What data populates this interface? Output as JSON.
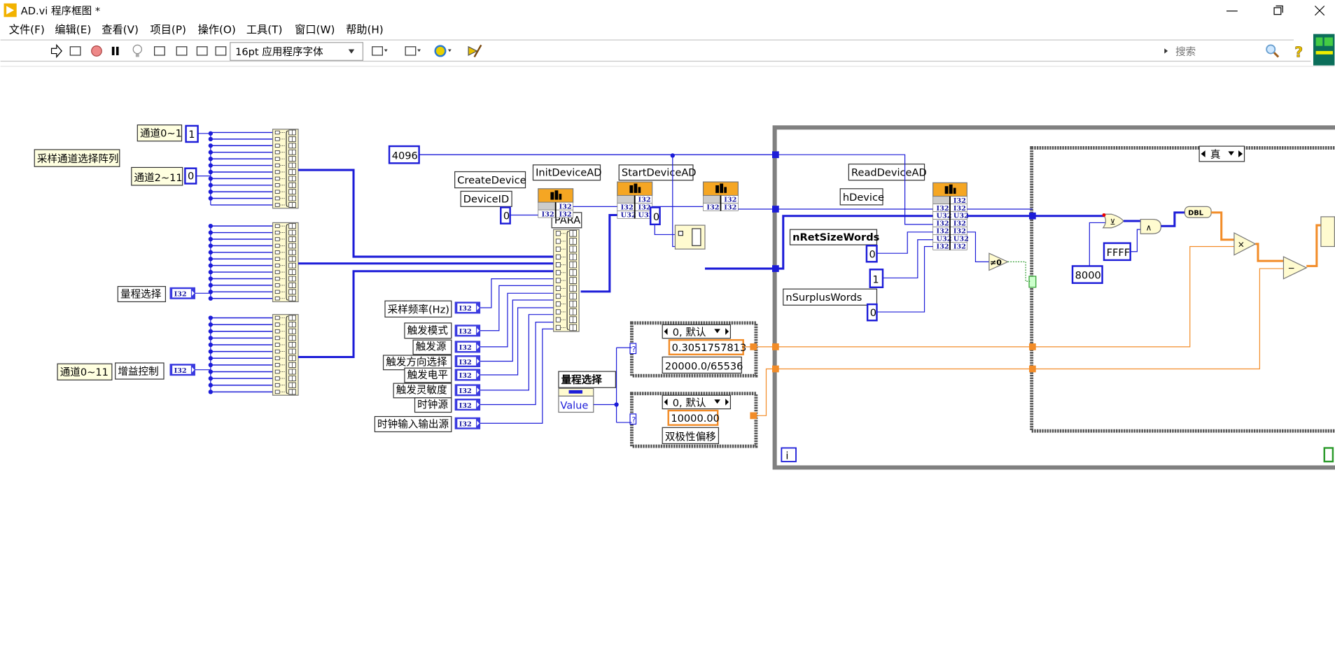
{
  "window": {
    "title": "AD.vi 程序框图 *"
  },
  "menu": [
    "文件(F)",
    "编辑(E)",
    "查看(V)",
    "项目(P)",
    "操作(O)",
    "工具(T)",
    "窗口(W)",
    "帮助(H)"
  ],
  "toolbar": {
    "icons": [
      "run-arrow",
      "run-continuous",
      "abort",
      "pause",
      "highlight-execution",
      "retain-wire-values",
      "step-into",
      "step-over",
      "step-out",
      "align",
      "distribute",
      "reorder",
      "cleanup"
    ],
    "font_select": "16pt 应用程序字体",
    "search_placeholder": "搜索",
    "help": "?"
  },
  "diagram": {
    "labels": {
      "sampling_array": "采样通道选择阵列",
      "ch01": "通道0~1",
      "ch211": "通道2~11",
      "range_select": "量程选择",
      "ch011": "通道0~11",
      "gain": "增益控制",
      "sample_rate": "采样频率(Hz)",
      "trig_mode": "触发模式",
      "trig_src": "触发源",
      "trig_dir": "触发方向选择",
      "trig_level": "触发电平",
      "trig_sens": "触发灵敏度",
      "clock_src": "时钟源",
      "clock_io": "时钟输入输出源",
      "para": "PARA",
      "create": "CreateDevice",
      "deviceid": "DeviceID",
      "init": "InitDeviceAD",
      "start": "StartDeviceAD",
      "read": "ReadDeviceAD",
      "hdevice": "hDevice",
      "nret": "nRetSizeWords",
      "nsurplus": "nSurplusWords",
      "range_node": "量程选择"
    },
    "constants": {
      "ch01": "1",
      "ch211": "0",
      "buf": "4096",
      "deviceid": "0",
      "init_len": "0",
      "nret": "0",
      "one": "1",
      "nsurplus": "0",
      "c8000": "8000",
      "ffff": "FFFF"
    },
    "case1": {
      "selector": "0, 默认",
      "value": "0.3051757813",
      "label": "20000.0/65536"
    },
    "case2": {
      "selector": "0, 默认",
      "value": "10000.00",
      "label": "双极性偏移"
    },
    "inner_case": {
      "selector": "真"
    },
    "tags": {
      "i32": "I32",
      "u32": "U32",
      "dbl": "DBL",
      "value": "Value",
      "ne0": "≠0",
      "iter": "i",
      "cond": "?",
      "mul": "×",
      "sub": "−",
      "and": "∧",
      "xor": "⊻"
    },
    "colors": {
      "int_wire": "#1c1cd8",
      "dbl_wire": "#f28c28",
      "clf_header": "#f5a623",
      "bool_wire": "#2a9a2a",
      "loop_border": "#808080"
    }
  }
}
